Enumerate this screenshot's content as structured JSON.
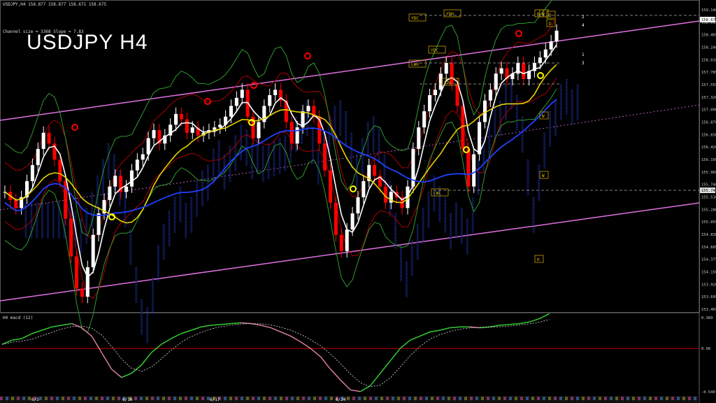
{
  "header": {
    "symbol_line": "USDJPY,H4  158.877 158.877 158.671 158.675",
    "channel_line": "Channel size = 3368 Slope = 7.83",
    "big_title": "USDJPY H4",
    "macd_label": "H4  macd (12)"
  },
  "price_axis": {
    "ticks": [
      "159.140",
      "158.695",
      "158.465",
      "158.240",
      "158.010",
      "157.785",
      "157.555",
      "157.320",
      "157.090",
      "156.870",
      "156.650",
      "156.420",
      "156.195",
      "155.965",
      "155.740",
      "155.510",
      "155.280",
      "155.055",
      "154.830",
      "154.605",
      "154.375",
      "154.150",
      "153.920",
      "153.695",
      "153.465"
    ],
    "current_price": "158.675",
    "marker_price": "155.740"
  },
  "macd_axis": {
    "ticks": [
      "0.389",
      "0.00",
      "-0.540"
    ]
  },
  "time_axis": {
    "labels": [
      "6/3",
      "6/10",
      "6/17",
      "6/24"
    ]
  },
  "annotations": {
    "box_labels": [
      "YDH",
      "YDC",
      "YDC",
      "LWH",
      "YDL",
      "LWL",
      "D",
      "D",
      "H",
      "W",
      "W",
      "W",
      "H"
    ],
    "line_numbers": [
      "2",
      "4",
      "1",
      "3"
    ]
  },
  "colors": {
    "background": "#000000",
    "bull_candle": "#ffffff",
    "bear_candle": "#ff0000",
    "channel": "#e070e0",
    "ma_white": "#ffffff",
    "ma_yellow": "#e6d200",
    "ma_blue": "#2040ff",
    "macd_green": "#33cc33",
    "macd_pink": "#d87aa0",
    "zero_line": "#cc0000"
  },
  "chart_data": {
    "type": "candlestick",
    "symbol": "USDJPY",
    "timeframe": "H4",
    "ylim": [
      153.465,
      159.14
    ],
    "closes": [
      155.7,
      155.55,
      155.4,
      155.6,
      155.9,
      156.2,
      156.5,
      156.8,
      156.6,
      156.3,
      155.9,
      155.2,
      154.5,
      153.9,
      153.75,
      154.3,
      154.9,
      155.3,
      155.55,
      155.8,
      156.0,
      155.7,
      155.8,
      156.1,
      156.3,
      156.4,
      156.7,
      156.85,
      156.6,
      156.75,
      156.95,
      157.15,
      157.05,
      156.8,
      156.9,
      156.75,
      156.8,
      156.85,
      156.9,
      156.95,
      157.1,
      157.3,
      157.45,
      157.6,
      157.1,
      156.7,
      157.0,
      157.3,
      157.5,
      157.6,
      157.4,
      157.0,
      156.6,
      156.9,
      157.2,
      157.3,
      157.1,
      156.6,
      156.1,
      155.5,
      154.9,
      154.6,
      155.0,
      155.3,
      155.6,
      155.9,
      156.2,
      156.0,
      155.8,
      155.5,
      155.7,
      155.6,
      155.4,
      155.8,
      156.5,
      156.9,
      157.2,
      157.5,
      157.6,
      157.9,
      158.1,
      157.7,
      157.3,
      156.5,
      155.8,
      156.4,
      157.0,
      157.4,
      157.6,
      157.9,
      158.0,
      157.8,
      157.9,
      158.1,
      157.8,
      157.95,
      158.1,
      158.2,
      158.35,
      158.5,
      158.7
    ],
    "indicator": "macd (12)",
    "macd": [
      0.05,
      0.1,
      0.12,
      0.18,
      0.22,
      0.26,
      0.28,
      0.3,
      0.25,
      0.15,
      -0.05,
      -0.25,
      -0.35,
      -0.3,
      -0.2,
      -0.05,
      0.05,
      0.12,
      0.18,
      0.22,
      0.26,
      0.28,
      0.29,
      0.3,
      0.31,
      0.3,
      0.28,
      0.25,
      0.2,
      0.15,
      0.08,
      0.0,
      -0.1,
      -0.25,
      -0.38,
      -0.5,
      -0.52,
      -0.45,
      -0.3,
      -0.15,
      0.0,
      0.1,
      0.15,
      0.2,
      0.22,
      0.25,
      0.26,
      0.26,
      0.25,
      0.26,
      0.28,
      0.29,
      0.3,
      0.32,
      0.36,
      0.42
    ],
    "macd_ylim": [
      -0.54,
      0.389
    ]
  }
}
